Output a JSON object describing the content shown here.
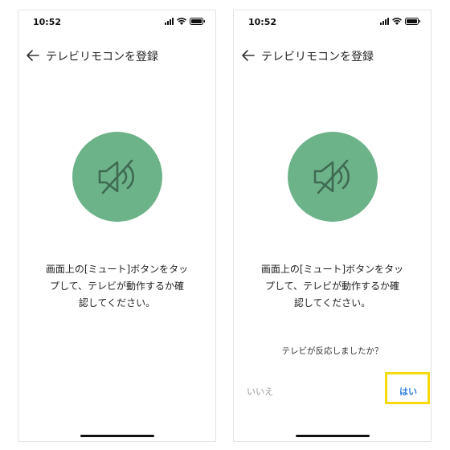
{
  "status": {
    "time": "10:52"
  },
  "header": {
    "title": "テレビリモコンを登録"
  },
  "instruction": {
    "lines": [
      "画面上の[ミュート]ボタンをタッ",
      "プして、テレビが動作するか確",
      "認してください。"
    ]
  },
  "confirm": {
    "question": "テレビが反応しましたか？",
    "no_label": "いいえ",
    "yes_label": "はい"
  },
  "colors": {
    "mute_circle": "#6db38a",
    "yes_button": "#2f80e0",
    "highlight_box": "#f5d90a",
    "no_button": "#9a9a9a"
  },
  "icons": {
    "mute": "speaker-muted-icon",
    "back": "arrow-left-icon"
  }
}
